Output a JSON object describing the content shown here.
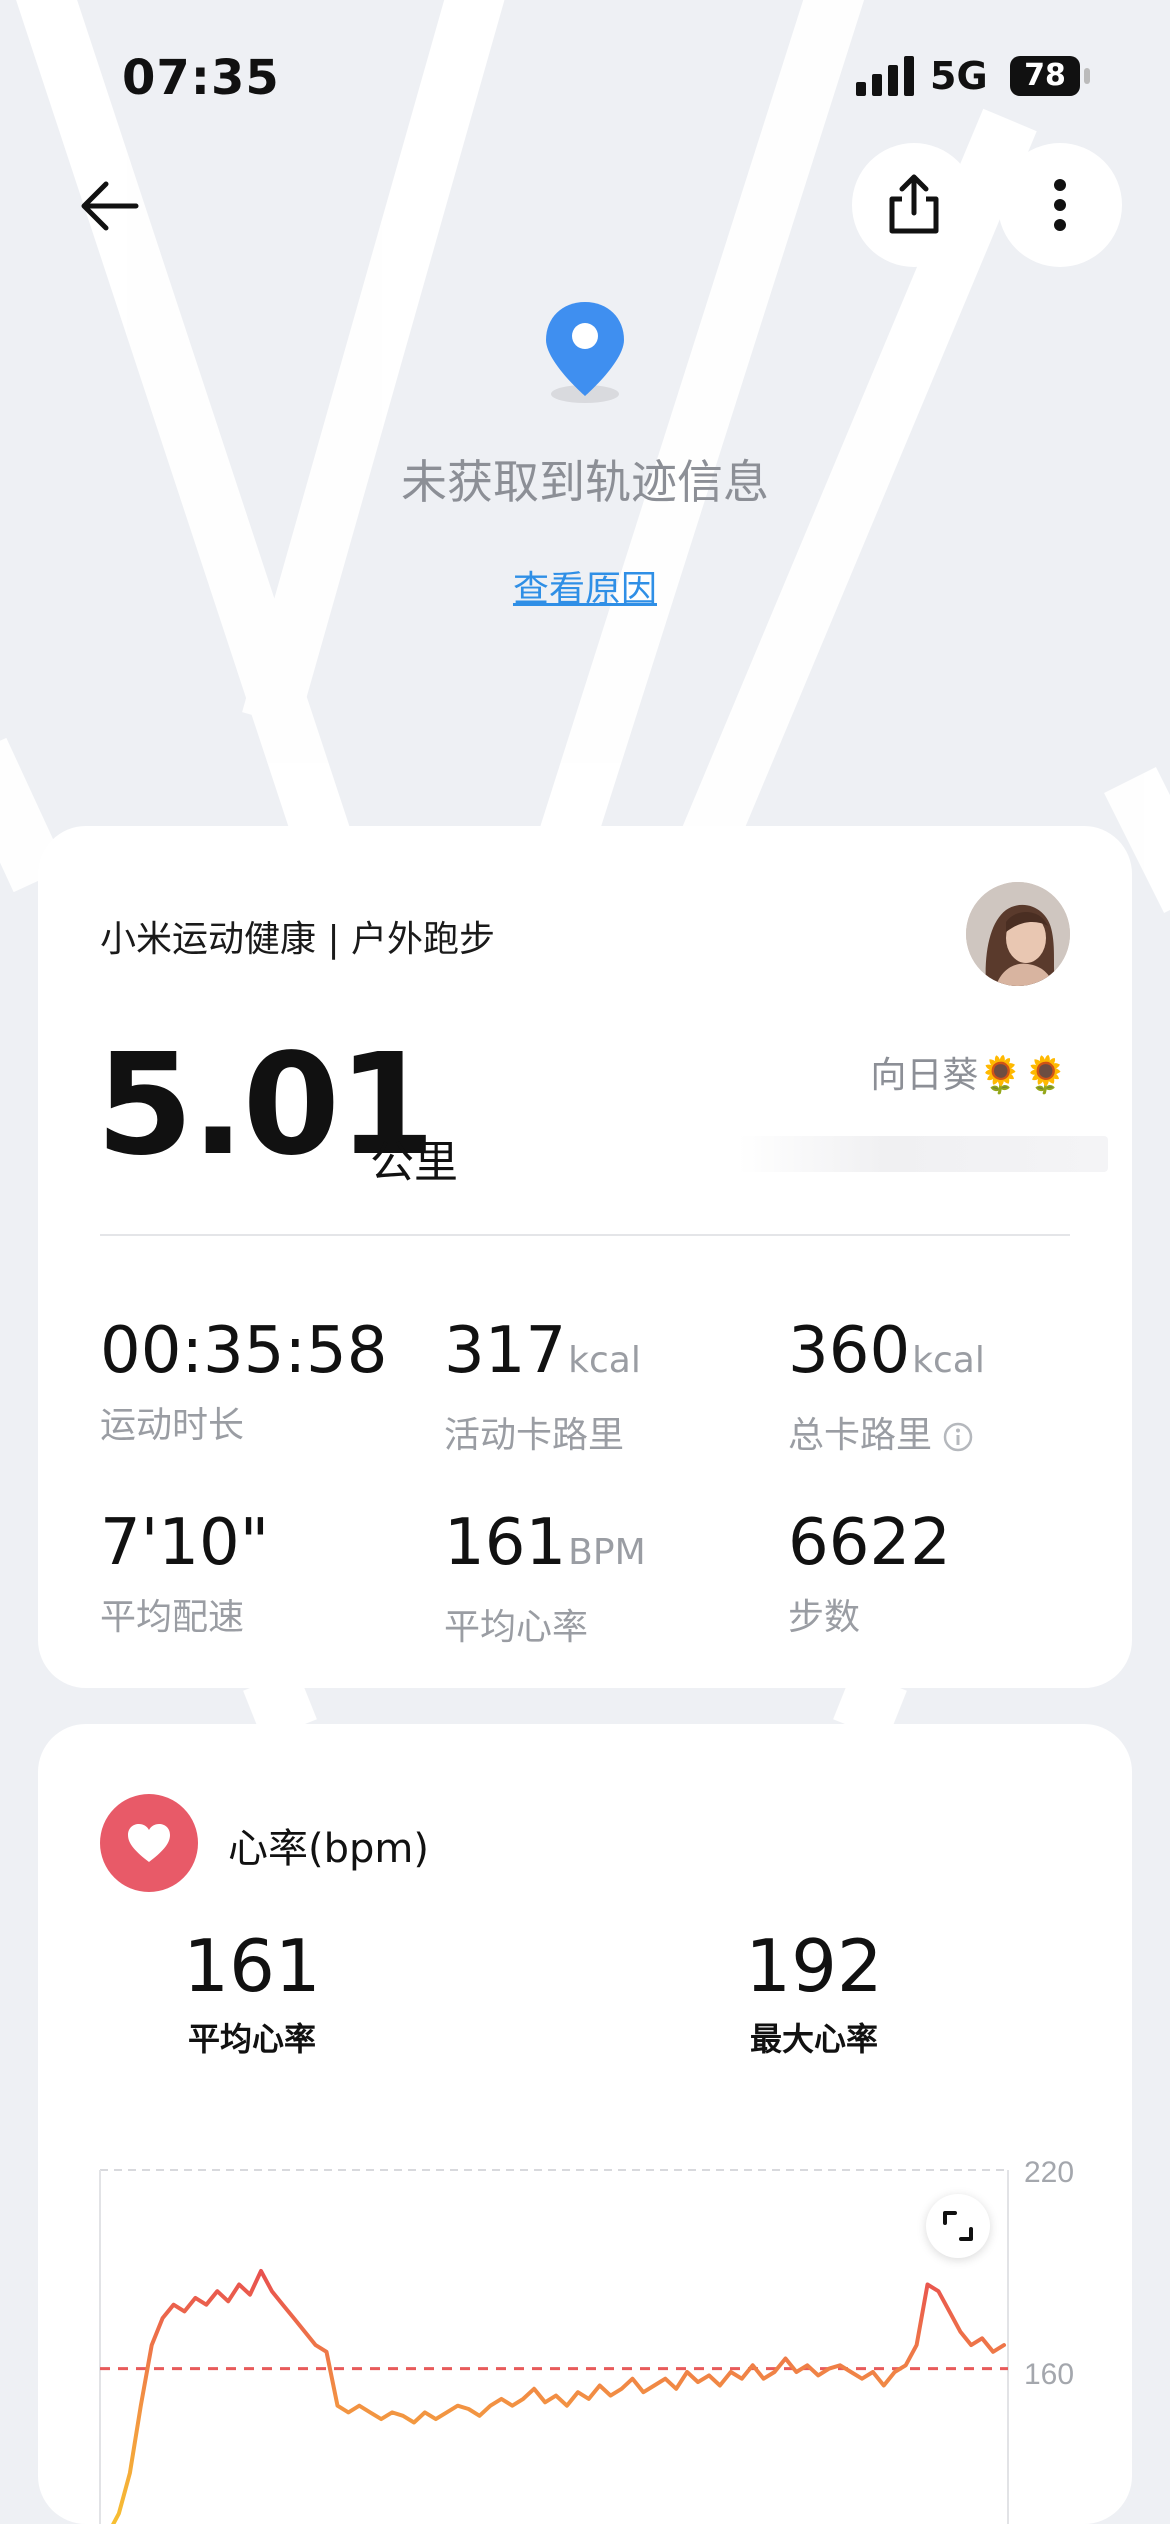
{
  "status_bar": {
    "time": "07:35",
    "network": "5G",
    "battery": "78"
  },
  "header": {
    "back_icon": "back-arrow-icon",
    "share_icon": "share-icon",
    "more_icon": "more-vertical-icon"
  },
  "track": {
    "message": "未获取到轨迹信息",
    "link": "查看原因",
    "icon": "location-pin-icon"
  },
  "summary": {
    "source": "小米运动健康 | 户外跑步",
    "distance": "5.01",
    "distance_unit": "公里",
    "nickname": "向日葵🌻🌻",
    "stats": [
      {
        "value": "00:35:58",
        "unit": "",
        "label": "运动时长"
      },
      {
        "value": "317",
        "unit": "kcal",
        "label": "活动卡路里"
      },
      {
        "value": "360",
        "unit": "kcal",
        "label": "总卡路里"
      },
      {
        "value": "7'10\"",
        "unit": "",
        "label": "平均配速"
      },
      {
        "value": "161",
        "unit": "BPM",
        "label": "平均心率"
      },
      {
        "value": "6622",
        "unit": "",
        "label": "步数"
      }
    ]
  },
  "heart_rate": {
    "title": "心率(bpm)",
    "avg_value": "161",
    "avg_label": "平均心率",
    "max_value": "192",
    "max_label": "最大心率"
  },
  "chart_data": {
    "type": "line",
    "title": "心率(bpm)",
    "y_ticks": [
      "220",
      "160"
    ],
    "ylim": [
      100,
      220
    ],
    "reference_line": 161,
    "series": [
      {
        "values": [
          110,
          118,
          130,
          150,
          168,
          176,
          180,
          178,
          182,
          180,
          184,
          181,
          186,
          183,
          190,
          184,
          180,
          176,
          172,
          168,
          166,
          150,
          148,
          150,
          148,
          146,
          148,
          147,
          145,
          148,
          146,
          148,
          150,
          149,
          147,
          150,
          152,
          150,
          152,
          155,
          151,
          153,
          150,
          154,
          152,
          156,
          153,
          155,
          158,
          154,
          156,
          158,
          155,
          160,
          157,
          159,
          156,
          160,
          158,
          162,
          158,
          160,
          164,
          160,
          162,
          159,
          161,
          162,
          160,
          158,
          160,
          156,
          160,
          162,
          168,
          186,
          184,
          178,
          172,
          168,
          170,
          166,
          168
        ]
      }
    ],
    "colors": {
      "low": "#f7c331",
      "mid": "#f29143",
      "high": "#e8504f",
      "reference": "#e85a5a"
    }
  }
}
